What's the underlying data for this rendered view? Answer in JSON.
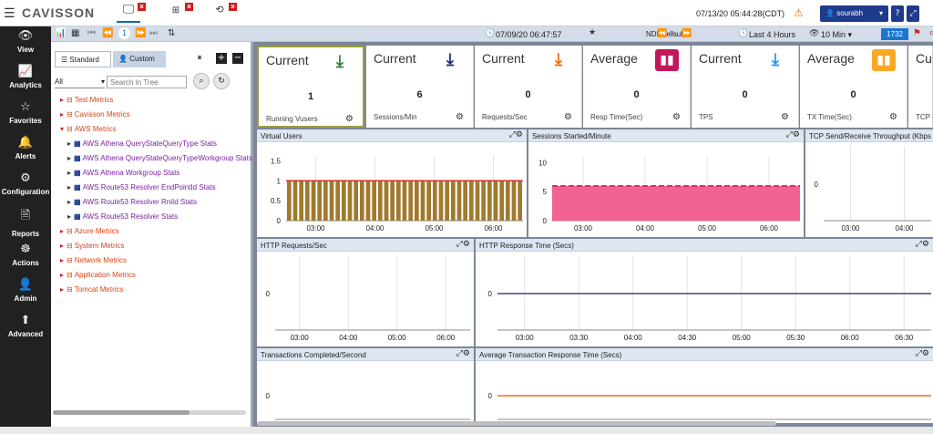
{
  "app": {
    "brand": "CAVISSON",
    "datetime": "07/13/20 05:44:28(CDT)",
    "user": "sourabh",
    "help": "?",
    "tabs": [
      {
        "icon": "monitor-icon",
        "close": "x"
      },
      {
        "icon": "graph-icon",
        "close": "x"
      },
      {
        "icon": "history-icon",
        "close": "x"
      }
    ]
  },
  "nav": [
    {
      "label": "View",
      "icon": "eye-icon"
    },
    {
      "label": "Analytics",
      "icon": "line-chart-icon"
    },
    {
      "label": "Favorites",
      "icon": "star-icon"
    },
    {
      "label": "Alerts",
      "icon": "bell-icon"
    },
    {
      "label": "Configuration",
      "icon": "gears-icon"
    },
    {
      "label": "Reports",
      "icon": "document-icon"
    },
    {
      "label": "Actions",
      "icon": "actions-icon"
    },
    {
      "label": "Admin",
      "icon": "user-icon"
    },
    {
      "label": "Advanced",
      "icon": "advanced-icon"
    }
  ],
  "toolbar": {
    "page_number": "1",
    "sample_date": "07/09/20 06:47:57",
    "profile": "NDEDefault",
    "duration": "Last 4 Hours",
    "interval": "10 Min",
    "count": "1732"
  },
  "tree": {
    "tab_standard": "Standard",
    "tab_custom": "Custom",
    "filter_value": "All",
    "search_placeholder": "Search In Tree",
    "items": [
      {
        "label": "Test Metrics",
        "level": 1,
        "expanded": false
      },
      {
        "label": "Cavisson Metrics",
        "level": 1,
        "expanded": false
      },
      {
        "label": "AWS Metrics",
        "level": 1,
        "expanded": true
      },
      {
        "label": "AWS Athena QueryStateQueryType Stats",
        "level": 2
      },
      {
        "label": "AWS Athena QueryStateQueryTypeWorkgroup Stats",
        "level": 2
      },
      {
        "label": "AWS Athena Workgroup Stats",
        "level": 2
      },
      {
        "label": "AWS Route53 Resolver EndPointId Stats",
        "level": 2
      },
      {
        "label": "AWS Route53 Resolver RniId Stats",
        "level": 2
      },
      {
        "label": "AWS Route53 Resolver Stats",
        "level": 2
      },
      {
        "label": "Azure Metrics",
        "level": 1,
        "expanded": false
      },
      {
        "label": "System Metrics",
        "level": 1,
        "expanded": false
      },
      {
        "label": "Network Metrics",
        "level": 1,
        "expanded": false
      },
      {
        "label": "Application Metrics",
        "level": 1,
        "expanded": false
      },
      {
        "label": "Tomcat Metrics",
        "level": 1,
        "expanded": false
      }
    ]
  },
  "cards": [
    {
      "title": "Current",
      "value": "1",
      "label": "Running Vusers",
      "icon": "download-arrow-icon",
      "color": "#2e7d32",
      "boxed": false,
      "glyph": "⤓"
    },
    {
      "title": "Current",
      "value": "6",
      "label": "Sessions/Min",
      "icon": "download-arrow-icon",
      "color": "#1a237e",
      "boxed": false,
      "glyph": "⤓"
    },
    {
      "title": "Current",
      "value": "0",
      "label": "Requests/Sec",
      "icon": "download-arrow-icon",
      "color": "#ef6c00",
      "boxed": false,
      "glyph": "⤓"
    },
    {
      "title": "Average",
      "value": "0",
      "label": "Resp Time(Sec)",
      "icon": "bar-chart-icon",
      "color": "#c2185b",
      "boxed": true,
      "glyph": "▮▮"
    },
    {
      "title": "Current",
      "value": "0",
      "label": "TPS",
      "icon": "download-arrow-icon",
      "color": "#2196f3",
      "boxed": false,
      "glyph": "⤓"
    },
    {
      "title": "Average",
      "value": "0",
      "label": "TX Time(Sec)",
      "icon": "bar-chart-icon",
      "color": "#f9a825",
      "boxed": true,
      "glyph": "▮▮"
    },
    {
      "title": "Cu",
      "value": "",
      "label": "TCP",
      "icon": "",
      "color": "#333333",
      "boxed": false,
      "glyph": ""
    }
  ],
  "chart_data": [
    {
      "type": "bar",
      "title": "Virtual Users",
      "x_ticks": [
        "03:00",
        "04:00",
        "05:00",
        "06:00"
      ],
      "y_ticks": [
        "0",
        "0.5",
        "1",
        "1.5"
      ],
      "ylim": [
        0,
        1.6
      ],
      "bar_count": 39,
      "values_constant": 1,
      "color": "#a07a2e",
      "line_color": "#d32f2f"
    },
    {
      "type": "area",
      "title": "Sessions Started/Minute",
      "x_ticks": [
        "03:00",
        "04:00",
        "05:00",
        "06:00"
      ],
      "y_ticks": [
        "0",
        "5",
        "10"
      ],
      "ylim": [
        0,
        11
      ],
      "values_constant": 6,
      "color": "#f06292",
      "line_color": "#c2185b"
    },
    {
      "type": "line",
      "title": "TCP Send/Receive Throughput (Kbps",
      "x_ticks": [
        "03:00",
        "04:00"
      ],
      "y_ticks": [
        "0"
      ],
      "values_constant": 0
    },
    {
      "type": "line",
      "title": "HTTP Requests/Sec",
      "x_ticks": [
        "03:00",
        "04:00",
        "05:00",
        "06:00"
      ],
      "y_ticks": [
        "0"
      ],
      "values_constant": 0
    },
    {
      "type": "line",
      "title": "HTTP Response Time (Secs)",
      "x_ticks": [
        "03:00",
        "03:30",
        "04:00",
        "04:30",
        "05:00",
        "05:30",
        "06:00",
        "06:30"
      ],
      "y_ticks": [
        "0"
      ],
      "values_constant": 0,
      "line_color": "#1a237e"
    },
    {
      "type": "line",
      "title": "Transactions Completed/Second",
      "x_ticks": [],
      "y_ticks": [
        "0"
      ],
      "values_constant": 0
    },
    {
      "type": "line",
      "title": "Average Transaction Response Time (Secs)",
      "x_ticks": [],
      "y_ticks": [
        "0"
      ],
      "values_constant": 0,
      "line_color": "#e65100"
    }
  ]
}
